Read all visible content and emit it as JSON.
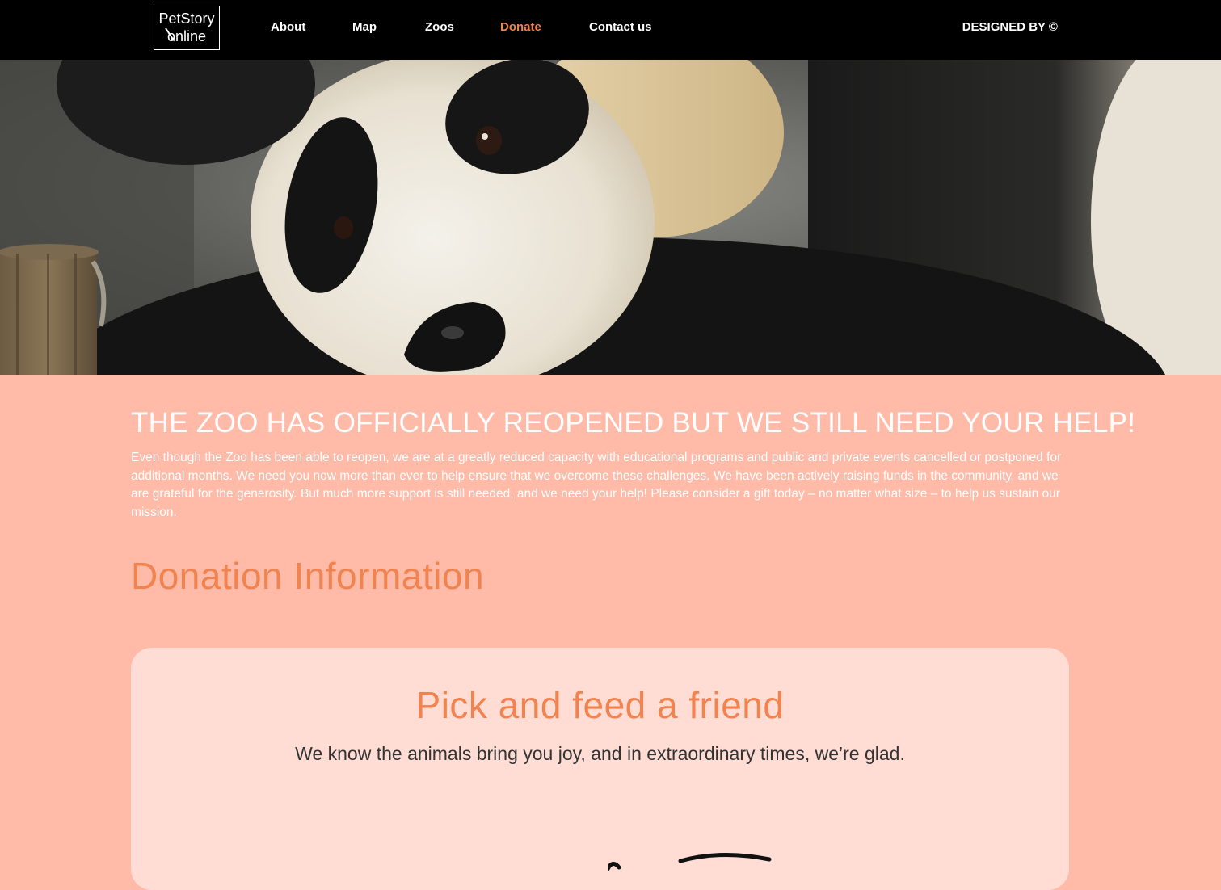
{
  "nav": {
    "logo_line1": "PetStory",
    "logo_line2": "online",
    "links": [
      "About",
      "Map",
      "Zoos",
      "Donate",
      "Contact us"
    ],
    "active": "Donate",
    "designed_by": "DESIGNED BY ©"
  },
  "hero": {
    "image": "panda-photo"
  },
  "content": {
    "headline": "THE ZOO HAS OFFICIALLY REOPENED BUT WE STILL NEED YOUR HELP!",
    "intro": "Even though the Zoo has been able to reopen, we are at a greatly reduced capacity with educational programs and public and private events cancelled or postponed for additional months. We need you now more than ever to help ensure that we overcome these challenges. We have been actively raising funds in the community, and we are grateful for the generosity. But much more support is still needed, and we need your help! Please consider a gift today – no matter what size – to help us sustain our mission.",
    "section_title": "Donation Information"
  },
  "card": {
    "title": "Pick and feed a friend",
    "subtitle": "We know the animals bring you joy, and in extraordinary times, we’re glad."
  },
  "colors": {
    "nav_bg": "#000000",
    "accent": "#f0834e",
    "page_bg": "#ffbaa8",
    "card_bg": "#ffdcd4"
  }
}
